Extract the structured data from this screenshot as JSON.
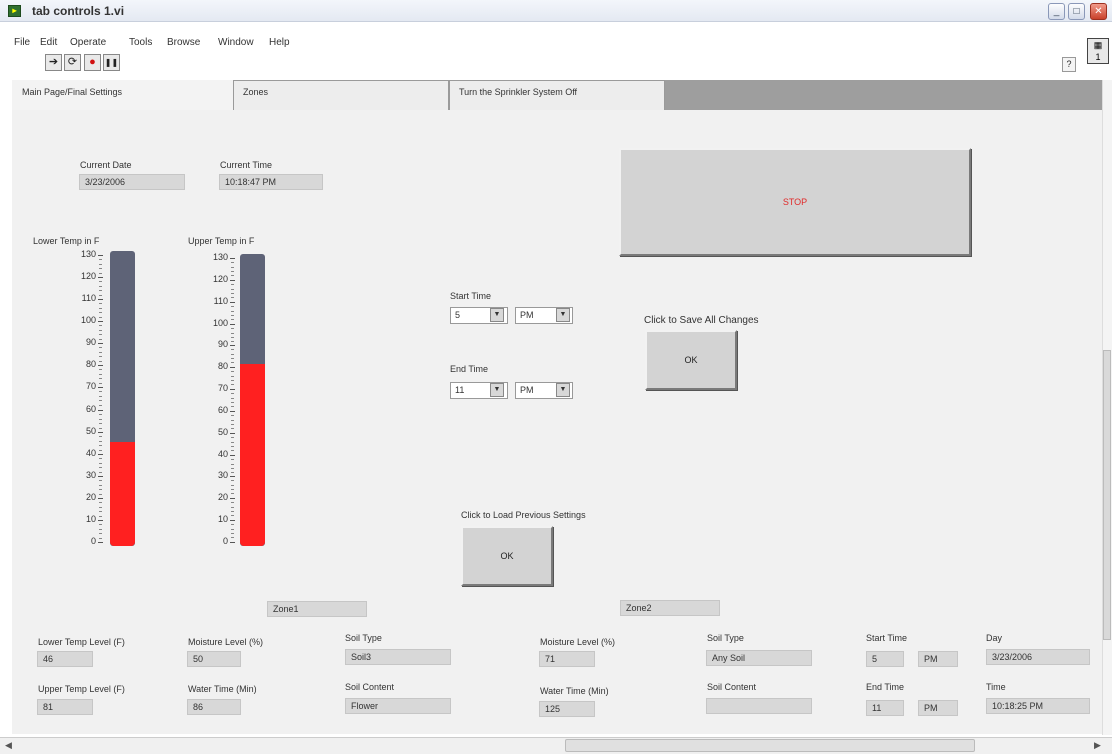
{
  "window": {
    "title": "tab controls 1.vi",
    "icon": "labview-vi-icon",
    "controls": [
      "_",
      "□",
      "X"
    ]
  },
  "menu": [
    "File",
    "Edit",
    "Operate",
    "Tools",
    "Browse",
    "Window",
    "Help"
  ],
  "toolbar": {
    "run_icon": "➔",
    "run_continuous_icon": "⟳",
    "abort_icon": "●",
    "pause_icon": "❚❚",
    "help_glyph": "?",
    "vi_icon_text": "1"
  },
  "tabs": [
    "Main Page/Final Settings",
    "Zones",
    "Turn the Sprinkler System Off"
  ],
  "current": {
    "date_label": "Current Date",
    "date_value": "3/23/2006",
    "time_label": "Current Time",
    "time_value": "10:18:47 PM"
  },
  "stop_label": "STOP",
  "thermometers": {
    "lower": {
      "label": "Lower Temp in F",
      "value": 46,
      "max": 130
    },
    "upper": {
      "label": "Upper Temp in F",
      "value": 81,
      "max": 130
    },
    "ticks": [
      "130",
      "120",
      "110",
      "100",
      "90",
      "80",
      "70",
      "60",
      "50",
      "40",
      "30",
      "20",
      "10",
      "0"
    ]
  },
  "schedule": {
    "start_label": "Start Time",
    "start_hour": "5",
    "start_ampm": "PM",
    "end_label": "End Time",
    "end_hour": "11",
    "end_ampm": "PM"
  },
  "save": {
    "label": "Click to Save All Changes",
    "button": "OK"
  },
  "load": {
    "label": "Click to Load Previous Settings",
    "button": "OK"
  },
  "zone1": {
    "name": "Zone1",
    "lower_temp_label": "Lower Temp Level (F)",
    "lower_temp": "46",
    "upper_temp_label": "Upper Temp Level (F)",
    "upper_temp": "81",
    "moisture_label": "Moisture Level (%)",
    "moisture": "50",
    "water_label": "Water Time (Min)",
    "water": "86",
    "soil_type_label": "Soil Type",
    "soil_type": "Soil3",
    "soil_content_label": "Soil Content",
    "soil_content": "Flower"
  },
  "zone2": {
    "name": "Zone2",
    "moisture_label": "Moisture Level (%)",
    "moisture": "71",
    "water_label": "Water Time (Min)",
    "water": "125",
    "soil_type_label": "Soil Type",
    "soil_type": "Any Soil",
    "soil_content_label": "Soil Content",
    "soil_content": "",
    "start_label": "Start Time",
    "start_hour": "5",
    "start_ampm": "PM",
    "end_label": "End Time",
    "end_hour": "11",
    "end_ampm": "PM",
    "day_label": "Day",
    "day": "3/23/2006",
    "time_label": "Time",
    "time": "10:18:25 PM"
  },
  "colors": {
    "thermo_fill": "#ff2020",
    "thermo_track": "#5e6377",
    "stop_text": "#e02a2a",
    "panel_bg": "#f1f1f1",
    "field_bg": "#d8d8d8"
  }
}
